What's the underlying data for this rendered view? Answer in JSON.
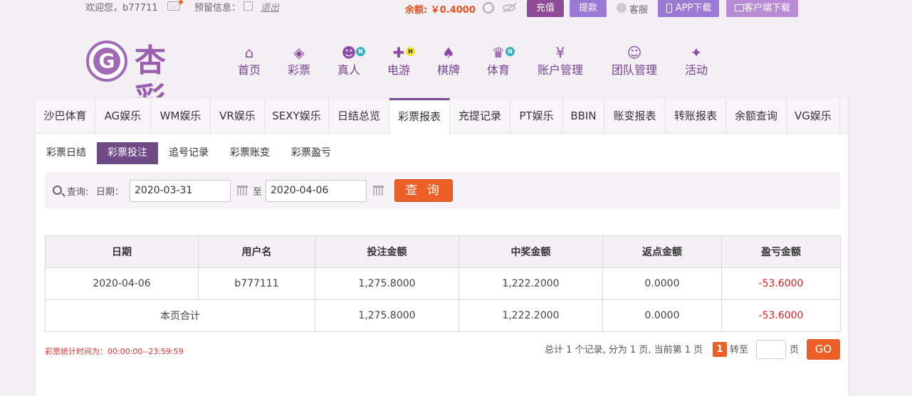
{
  "topbar": {
    "welcome": "欢迎您，b77711",
    "reserved_info": "预留信息：",
    "logout": "退出",
    "balance_label": "余额: ￥0.4000",
    "recharge": "充值",
    "withdraw": "提款",
    "service": "客服",
    "app_download": "APP下载",
    "client_download": "客户端下载"
  },
  "logo": {
    "text": "杏彩",
    "mark": "G"
  },
  "nav": [
    {
      "label": "首页",
      "icon": "home-icon",
      "glyph": "⌂"
    },
    {
      "label": "彩票",
      "icon": "ticket-icon",
      "glyph": "◈"
    },
    {
      "label": "真人",
      "icon": "dealer-icon",
      "glyph": "☻",
      "badge": "N"
    },
    {
      "label": "电游",
      "icon": "gamepad-icon",
      "glyph": "✚",
      "badge": "H"
    },
    {
      "label": "棋牌",
      "icon": "cards-icon",
      "glyph": "♠"
    },
    {
      "label": "体育",
      "icon": "trophy-icon",
      "glyph": "♛",
      "badge": "N"
    },
    {
      "label": "账户管理",
      "icon": "yen-icon",
      "glyph": "¥"
    },
    {
      "label": "团队管理",
      "icon": "team-icon",
      "glyph": "☺"
    },
    {
      "label": "活动",
      "icon": "gift-icon",
      "glyph": "✦"
    }
  ],
  "tabs": [
    "沙巴体育",
    "AG娱乐",
    "WM娱乐",
    "VR娱乐",
    "SEXY娱乐",
    "日结总览",
    "彩票报表",
    "充提记录",
    "PT娱乐",
    "BBIN",
    "账变报表",
    "转账报表",
    "余额查询",
    "VG娱乐"
  ],
  "active_tab": "彩票报表",
  "subtabs": [
    "彩票日结",
    "彩票投注",
    "追号记录",
    "彩票账变",
    "彩票盈亏"
  ],
  "active_subtab": "彩票投注",
  "search": {
    "query_label": "查询:",
    "date_label": "日期：",
    "start_date": "2020-03-31",
    "to_label": "至",
    "end_date": "2020-04-06",
    "button": "查 询"
  },
  "table": {
    "headers": [
      "日期",
      "用户名",
      "投注金额",
      "中奖金额",
      "返点金额",
      "盈亏金额"
    ],
    "rows": [
      [
        "2020-04-06",
        "b777111",
        "1,275.8000",
        "1,222.2000",
        "0.0000",
        "-53.6000"
      ]
    ],
    "total": {
      "label": "本页合计",
      "bet": "1,275.8000",
      "win": "1,222.2000",
      "rebate": "0.0000",
      "profit": "-53.6000"
    }
  },
  "stat_time": "彩票统计时间为：00:00:00--23:59:59",
  "pager": {
    "summary": "总计 1 个记录, 分为 1 页, 当前第 1 页",
    "current": "1",
    "goto_label": "转至",
    "page_unit": "页",
    "go": "GO"
  },
  "colors": {
    "brand": "#8e4b97",
    "accent": "#ec5f26",
    "negative": "#e02020"
  }
}
